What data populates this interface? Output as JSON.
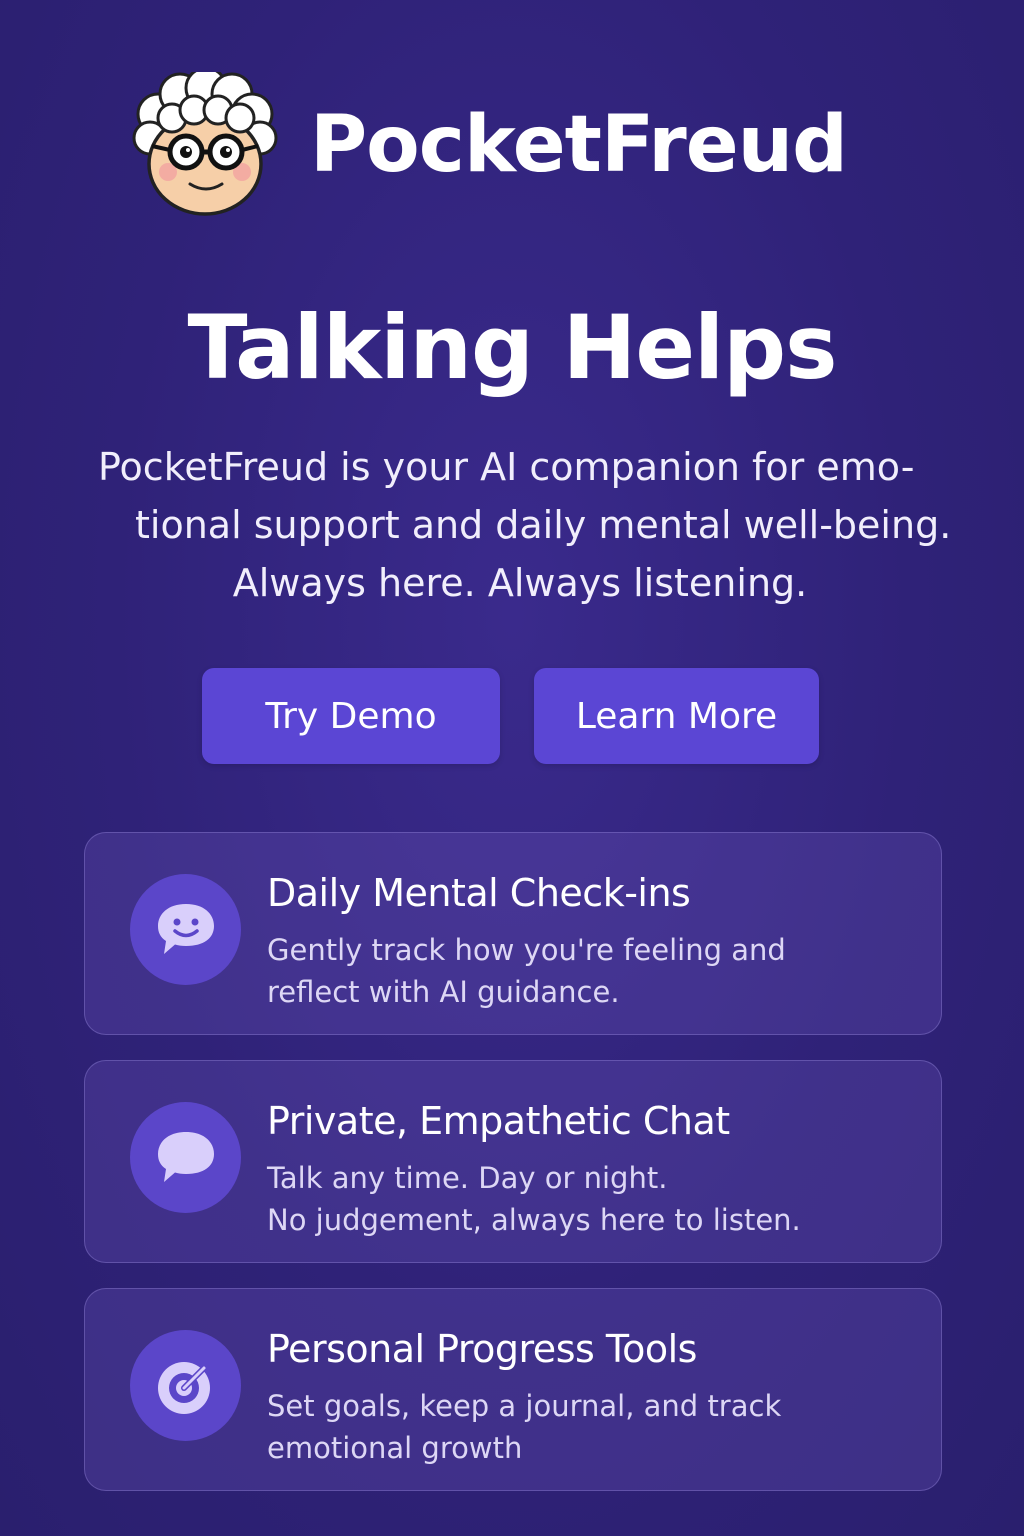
{
  "brand": {
    "name": "PocketFreud",
    "mascot_icon": "freud-mascot-icon"
  },
  "hero": {
    "title": "Talking Helps",
    "description_lines": [
      "PocketFreud is your AI companion for emo-",
      "tional support and daily mental well-being.",
      "Always here. Always listening."
    ]
  },
  "actions": {
    "try_demo": "Try Demo",
    "learn_more": "Learn More"
  },
  "features": [
    {
      "icon": "smiley-chat-icon",
      "title": "Daily Mental Check-ins",
      "lines": [
        "Gently track how you're feeling and",
        "reflect with AI guidance."
      ]
    },
    {
      "icon": "chat-bubble-icon",
      "title": "Private, Empathetic Chat",
      "lines": [
        "Talk any time. Day or night.",
        "No judgement, always here to listen."
      ]
    },
    {
      "icon": "target-icon",
      "title": "Personal Progress Tools",
      "lines": [
        "Set goals, keep a journal, and track",
        "emotional growth"
      ]
    }
  ],
  "colors": {
    "background": "#2f2278",
    "button": "#5b46d4",
    "icon_circle": "#5b46c9",
    "icon_glyph": "#d9cffb"
  }
}
